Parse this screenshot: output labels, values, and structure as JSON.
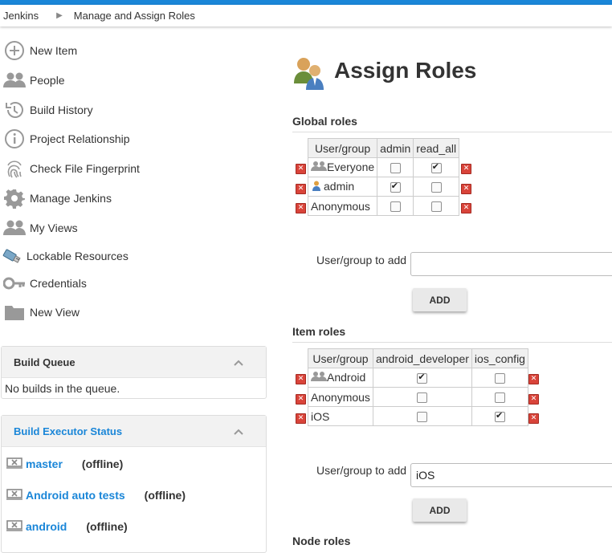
{
  "breadcrumb": {
    "root": "Jenkins",
    "current": "Manage and Assign Roles"
  },
  "sidebar": {
    "items": [
      {
        "label": "New Item",
        "icon": "plus-circle-icon"
      },
      {
        "label": "People",
        "icon": "people-icon"
      },
      {
        "label": "Build History",
        "icon": "history-icon"
      },
      {
        "label": "Project Relationship",
        "icon": "info-icon"
      },
      {
        "label": "Check File Fingerprint",
        "icon": "fingerprint-icon"
      },
      {
        "label": "Manage Jenkins",
        "icon": "gear-icon"
      },
      {
        "label": "My Views",
        "icon": "people-icon"
      },
      {
        "label": "Lockable Resources",
        "icon": "usb-icon"
      },
      {
        "label": "Credentials",
        "icon": "key-icon"
      },
      {
        "label": "New View",
        "icon": "folder-icon"
      }
    ]
  },
  "build_queue": {
    "title": "Build Queue",
    "empty": "No builds in the queue."
  },
  "executors": {
    "title": "Build Executor Status",
    "items": [
      {
        "name": "master",
        "status": "(offline)"
      },
      {
        "name": "Android auto tests",
        "status": "(offline)"
      },
      {
        "name": "android",
        "status": "(offline)"
      }
    ]
  },
  "page": {
    "title": "Assign Roles"
  },
  "global_roles": {
    "title": "Global roles",
    "header": [
      "User/group",
      "admin",
      "read_all"
    ],
    "rows": [
      {
        "name": "Everyone",
        "icon": "group-icon",
        "checks": [
          false,
          true
        ]
      },
      {
        "name": "admin",
        "icon": "user-icon",
        "checks": [
          true,
          false
        ]
      },
      {
        "name": "Anonymous",
        "icon": "",
        "checks": [
          false,
          false
        ]
      }
    ],
    "add_label": "User/group to add",
    "add_value": "",
    "add_button": "ADD"
  },
  "item_roles": {
    "title": "Item roles",
    "header": [
      "User/group",
      "android_developer",
      "ios_config"
    ],
    "rows": [
      {
        "name": "Android",
        "icon": "group-icon",
        "checks": [
          true,
          false
        ]
      },
      {
        "name": "Anonymous",
        "icon": "",
        "checks": [
          false,
          false
        ]
      },
      {
        "name": "iOS",
        "icon": "",
        "checks": [
          false,
          true
        ]
      }
    ],
    "add_label": "User/group to add",
    "add_value": "iOS",
    "add_button": "ADD"
  },
  "node_roles": {
    "title": "Node roles"
  },
  "colors": {
    "accent": "#1a86d8",
    "delete": "#d9443a"
  }
}
